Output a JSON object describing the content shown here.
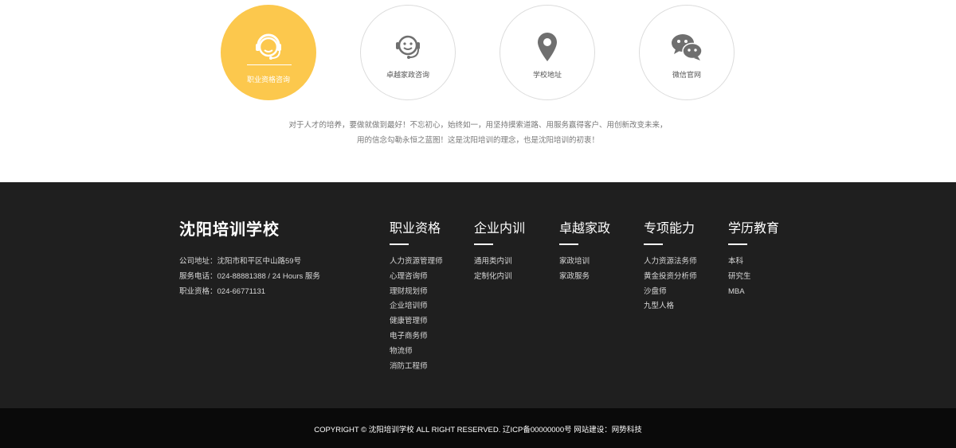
{
  "services": [
    {
      "label": "职业资格咨询",
      "icon": "headset-agent-icon",
      "active": true
    },
    {
      "label": "卓越家政咨询",
      "icon": "smile-headset-icon",
      "active": false
    },
    {
      "label": "学校地址",
      "icon": "location-pin-icon",
      "active": false
    },
    {
      "label": "微信官网",
      "icon": "wechat-icon",
      "active": false
    }
  ],
  "intro": {
    "line1": "对于人才的培养，要做就做到最好！不忘初心，始终如一，用坚持摸索道路、用服务赢得客户、用创新改变未来，",
    "line2": "用的信念勾勒永恒之蓝图！这是沈阳培训的理念，也是沈阳培训的初衷！"
  },
  "footer": {
    "brand": "沈阳培训学校",
    "address": "公司地址：沈阳市和平区中山路59号",
    "phone": "服务电话：024-88881388 / 24 Hours 服务",
    "cert": "职业资格：024-66771131",
    "columns": [
      {
        "title": "职业资格",
        "links": [
          "人力资源管理师",
          "心理咨询师",
          "理财规划师",
          "企业培训师",
          "健康管理师",
          "电子商务师",
          "物流师",
          "消防工程师"
        ]
      },
      {
        "title": "企业内训",
        "links": [
          "通用类内训",
          "定制化内训"
        ]
      },
      {
        "title": "卓越家政",
        "links": [
          "家政培训",
          "家政服务"
        ]
      },
      {
        "title": "专项能力",
        "links": [
          "人力资源法务师",
          "黄金投资分析师",
          "沙盘师",
          "九型人格"
        ]
      },
      {
        "title": "学历教育",
        "links": [
          "本科",
          "研究生",
          "MBA"
        ]
      }
    ]
  },
  "copyright": "COPYRIGHT © 沈阳培训学校  ALL RIGHT RESERVED.  辽ICP备00000000号  网站建设：网势科技",
  "colors": {
    "accent": "#fcc84d",
    "footer_bg": "#1f1f1f",
    "bottom_bg": "#0a0a0a",
    "icon_gray": "#6f6f6f"
  }
}
